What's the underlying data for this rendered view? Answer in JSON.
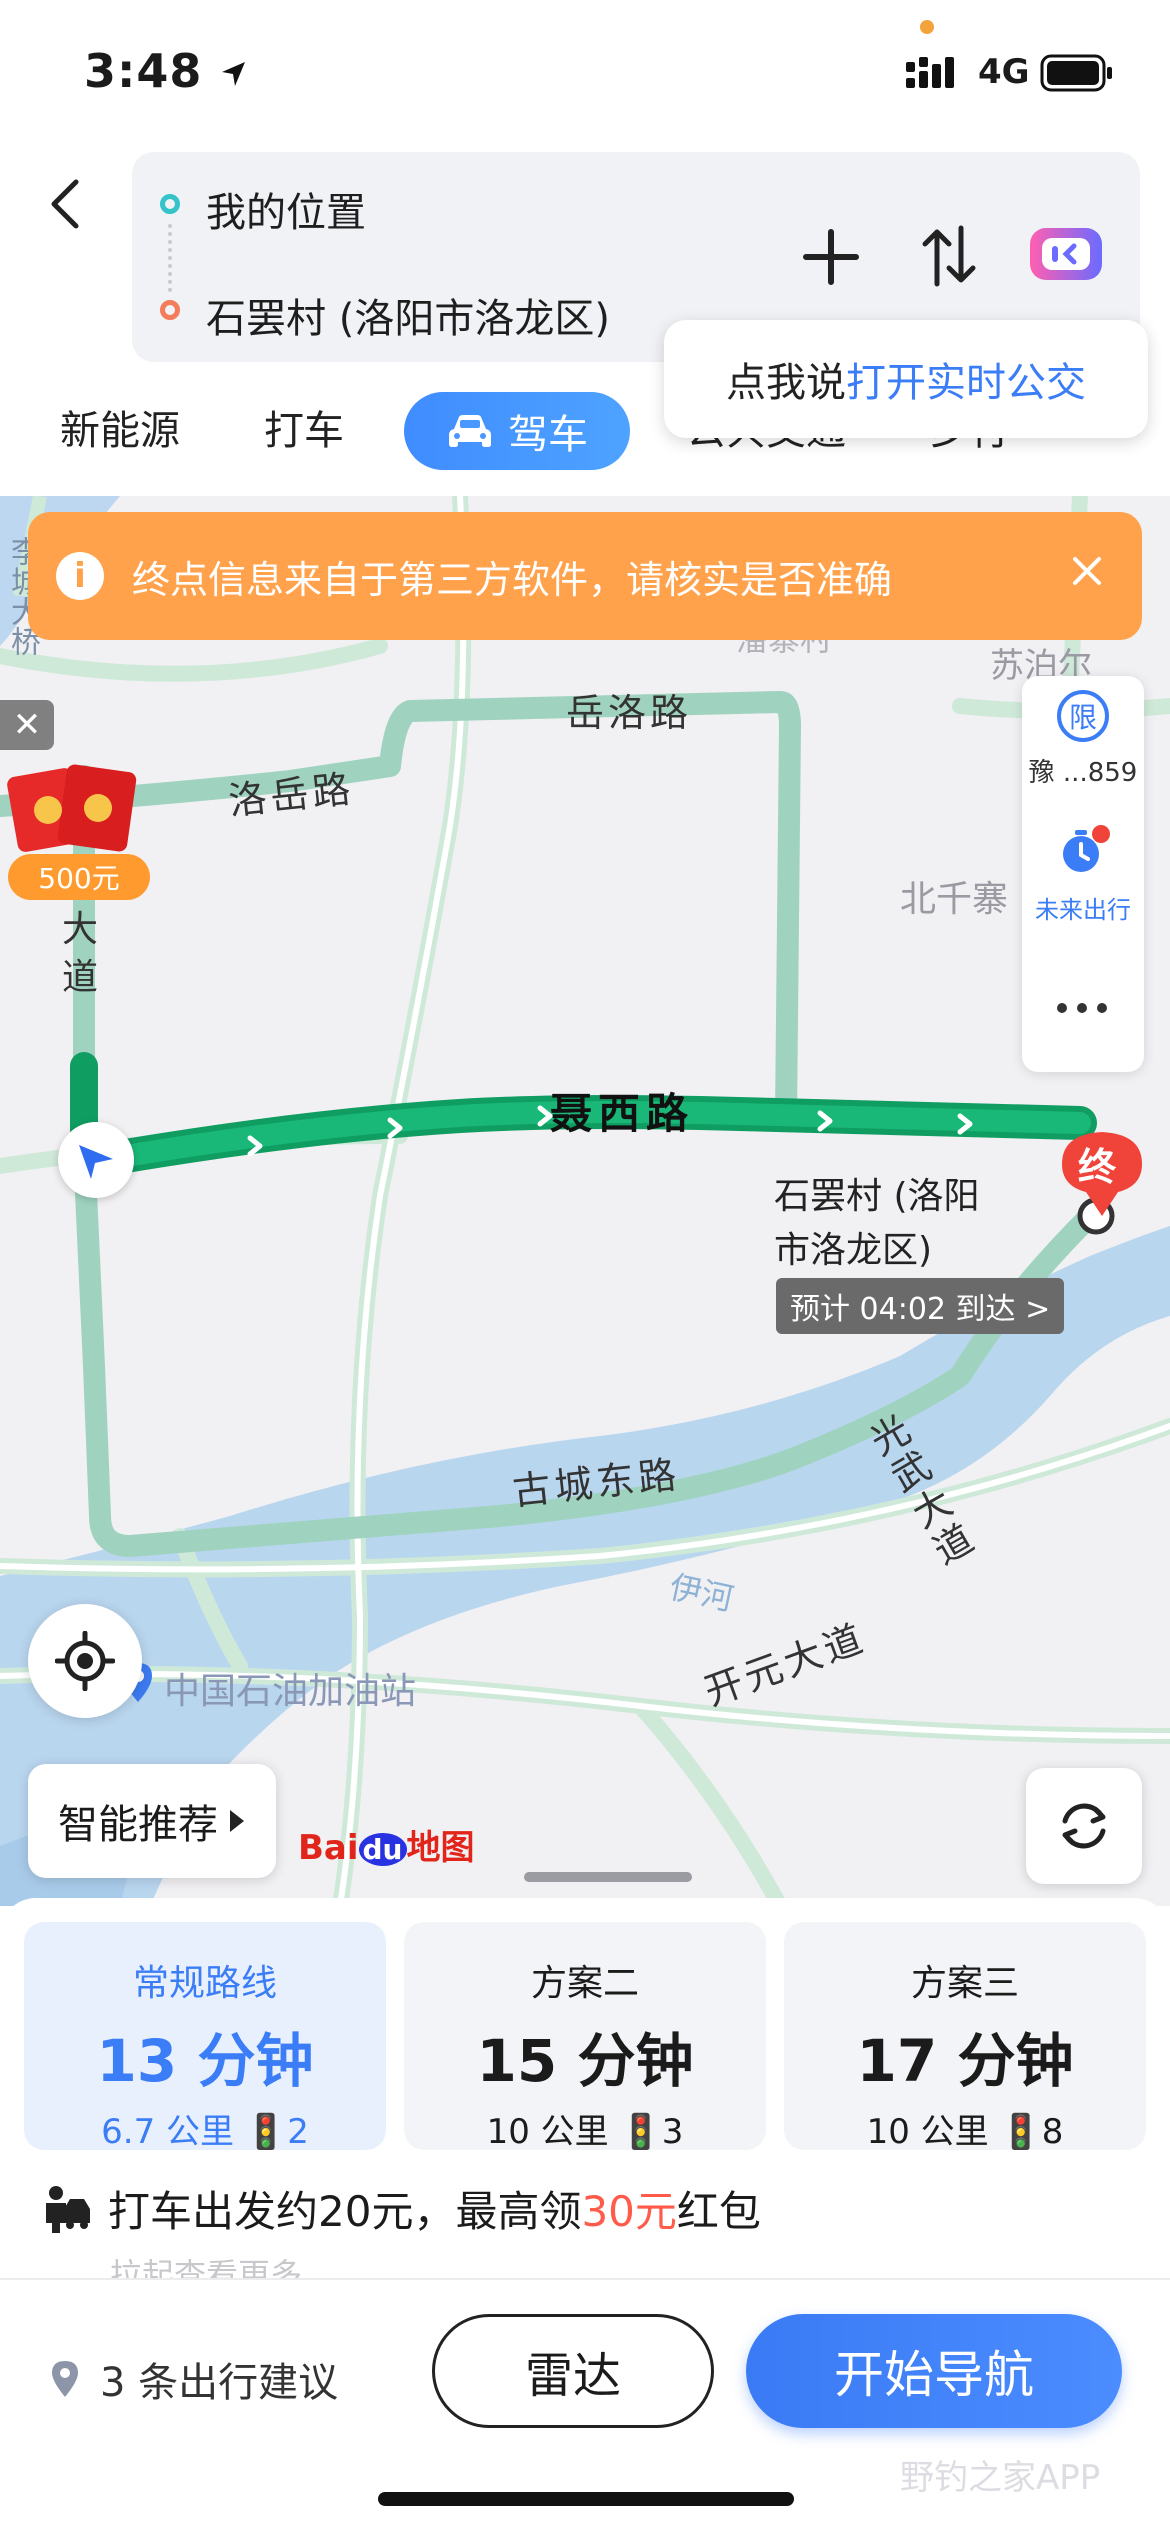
{
  "status": {
    "time": "3:48",
    "network": "4G"
  },
  "route": {
    "origin": "我的位置",
    "destination": "石罢村 (洛阳市洛龙区)"
  },
  "voice_bubble": {
    "prefix": "点我说",
    "highlight": "打开实时公交"
  },
  "tabs": [
    {
      "label": "新能源"
    },
    {
      "label": "打车"
    },
    {
      "label": "驾车",
      "active": true
    },
    {
      "label": "公共交通"
    },
    {
      "label": "步行"
    }
  ],
  "banner": {
    "text": "终点信息来自于第三方软件，请核实是否准确"
  },
  "side_panel": {
    "limit_icon": "限",
    "plate": "豫 ...859",
    "future": "未来出行"
  },
  "red_packet": {
    "amount": "500元"
  },
  "map_labels": {
    "road_yueluo": "岳洛路",
    "road_luoyue": "洛岳路",
    "road_niexi": "聂西路",
    "road_gucheng": "古城东路",
    "road_guangwu": "光武大道",
    "road_kaiyuan": "开元大道",
    "river_yi": "伊河",
    "village_bei": "北千寨",
    "village_su": "苏泊尔",
    "village_pan": "潘寨村",
    "da": "大",
    "dao": "道",
    "gas_station": "中国石油加油站",
    "dest_line1": "石罢村 (洛阳",
    "dest_line2": "市洛龙区)",
    "eta": "预计 04:02 到达 >",
    "end_marker": "终",
    "left_edge": "李城大桥"
  },
  "smart_recommend": "智能推荐",
  "brand": {
    "bai": "Bai",
    "du": "du",
    "map": "地图"
  },
  "route_options": [
    {
      "name": "常规路线",
      "time": "13 分钟",
      "distance": "6.7 公里",
      "lights": "2"
    },
    {
      "name": "方案二",
      "time": "15 分钟",
      "distance": "10 公里",
      "lights": "3"
    },
    {
      "name": "方案三",
      "time": "17 分钟",
      "distance": "10 公里",
      "lights": "8"
    }
  ],
  "taxi_promo": {
    "prefix": "打车出发约20元，最高领",
    "amount": "30元",
    "suffix": "红包"
  },
  "pull_hint": "拉起查看更多",
  "suggestions": "3 条出行建议",
  "buttons": {
    "radar": "雷达",
    "start_nav": "开始导航"
  },
  "watermark": "野钓之家APP",
  "colors": {
    "accent": "#3b7df6",
    "route_green": "#12a56a",
    "alt_route": "#9fd3bf",
    "banner_orange": "#ffa24b",
    "promo_red": "#ff5a4a"
  }
}
